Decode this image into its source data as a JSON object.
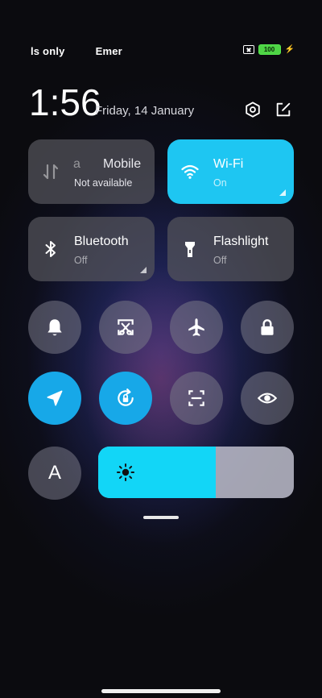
{
  "status_bar": {
    "carrier_left": "ls only",
    "carrier_right": "Emer",
    "battery_level": "100",
    "charging": true
  },
  "header": {
    "time": "1:56",
    "date": "Friday, 14 January",
    "icons": [
      "settings-hex-icon",
      "edit-icon"
    ]
  },
  "tiles": {
    "mobile": {
      "prefix": "a",
      "title": "Mobile",
      "subtitle": "Not available",
      "active": false
    },
    "wifi": {
      "title": "Wi-Fi",
      "subtitle": "On",
      "active": true
    },
    "bluetooth": {
      "title": "Bluetooth",
      "subtitle": "Off",
      "active": false
    },
    "flashlight": {
      "title": "Flashlight",
      "subtitle": "Off",
      "active": false
    }
  },
  "toggles": [
    {
      "name": "bell-icon",
      "active": false
    },
    {
      "name": "screenshot-icon",
      "active": false
    },
    {
      "name": "airplane-icon",
      "active": false
    },
    {
      "name": "lock-icon",
      "active": false
    },
    {
      "name": "location-icon",
      "active": true
    },
    {
      "name": "rotation-lock-icon",
      "active": true
    },
    {
      "name": "scanner-icon",
      "active": false
    },
    {
      "name": "eye-icon",
      "active": false
    }
  ],
  "auto_brightness": {
    "label": "A"
  },
  "brightness": {
    "level": 0.6
  },
  "colors": {
    "accent": "#1ec6f2",
    "battery": "#4ed445"
  }
}
